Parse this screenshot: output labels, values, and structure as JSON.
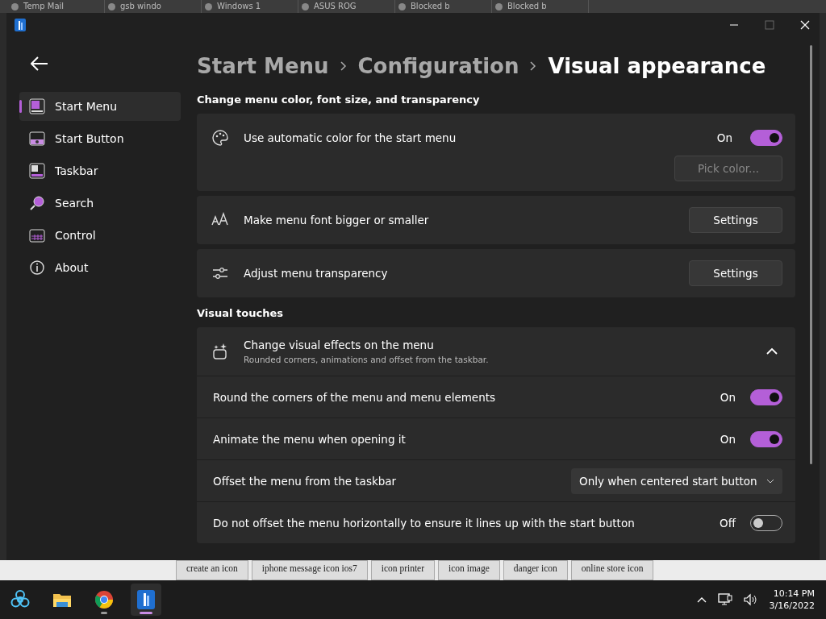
{
  "browser_tabs": [
    {
      "title": "Temp Mail"
    },
    {
      "title": "gsb windo"
    },
    {
      "title": "Windows 1"
    },
    {
      "title": "ASUS ROG"
    },
    {
      "title": "Blocked b"
    },
    {
      "title": "Blocked b"
    }
  ],
  "breadcrumb": [
    "Start Menu",
    "Configuration",
    "Visual appearance"
  ],
  "sidebar": {
    "items": [
      {
        "label": "Start Menu",
        "selected": true
      },
      {
        "label": "Start Button",
        "selected": false
      },
      {
        "label": "Taskbar",
        "selected": false
      },
      {
        "label": "Search",
        "selected": false
      },
      {
        "label": "Control",
        "selected": false
      },
      {
        "label": "About",
        "selected": false
      }
    ]
  },
  "sections": [
    {
      "heading": "Change menu color, font size, and transparency",
      "cards": [
        {
          "kind": "toggle",
          "label": "Use automatic color for the start menu",
          "on": true,
          "state_label": "On",
          "button": {
            "label": "Pick color...",
            "disabled": true
          }
        },
        {
          "kind": "button",
          "label": "Make menu font bigger or smaller",
          "button": {
            "label": "Settings",
            "disabled": false
          }
        },
        {
          "kind": "button",
          "label": "Adjust menu transparency",
          "button": {
            "label": "Settings",
            "disabled": false
          }
        }
      ]
    },
    {
      "heading": "Visual touches",
      "cards": [
        {
          "kind": "expander",
          "label": "Change visual effects on the menu",
          "subtitle": "Rounded corners, animations and offset from the taskbar.",
          "expanded": true,
          "rows": [
            {
              "kind": "toggle",
              "label": "Round the corners of the menu and menu elements",
              "on": true,
              "state_label": "On"
            },
            {
              "kind": "toggle",
              "label": "Animate the menu when opening it",
              "on": true,
              "state_label": "On"
            },
            {
              "kind": "dropdown",
              "label": "Offset the menu from the taskbar",
              "value": "Only when centered start button"
            },
            {
              "kind": "toggle",
              "label": "Do not offset the menu horizontally to ensure it lines up with the start button",
              "on": false,
              "state_label": "Off"
            }
          ]
        }
      ]
    }
  ],
  "web_tags": [
    "create an icon",
    "iphone message icon ios7",
    "icon printer",
    "icon image",
    "danger icon",
    "online store icon"
  ],
  "taskbar": {
    "apps": [
      {
        "running": false,
        "active": false
      },
      {
        "running": false,
        "active": false
      },
      {
        "running": true,
        "active": false
      },
      {
        "running": true,
        "active": true
      }
    ],
    "time": "10:14 PM",
    "date": "3/16/2022"
  }
}
